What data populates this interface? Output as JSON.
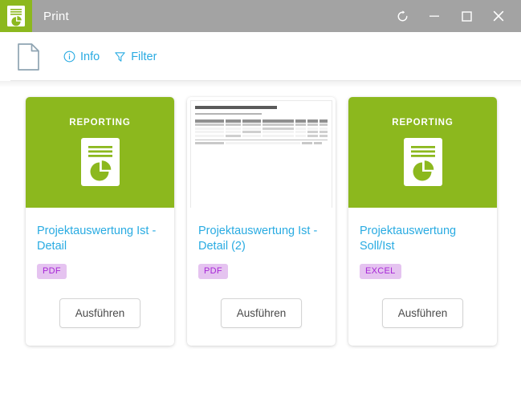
{
  "window": {
    "title": "Print",
    "logo_icon": "report-pie-document-icon",
    "controls": [
      {
        "name": "refresh-button",
        "icon": "refresh-icon"
      },
      {
        "name": "minimize-button",
        "icon": "minimize-icon"
      },
      {
        "name": "maximize-button",
        "icon": "maximize-icon"
      },
      {
        "name": "close-button",
        "icon": "close-icon"
      }
    ],
    "colors": {
      "titlebar": "#a3a3a3",
      "accent_green": "#8cb81e",
      "link_blue": "#29abe2",
      "badge_bg": "#e5c3f0",
      "badge_text": "#a626d6"
    }
  },
  "toolbar": {
    "document_icon": "document-icon",
    "actions": [
      {
        "label": "Info",
        "icon": "info-circle-icon"
      },
      {
        "label": "Filter",
        "icon": "filter-funnel-icon"
      }
    ]
  },
  "cards": [
    {
      "header_type": "reporting",
      "header_label": "REPORTING",
      "header_icon": "report-pie-document-icon",
      "title": "Projektauswertung Ist - Detail",
      "badge": "PDF",
      "button_label": "Ausführen"
    },
    {
      "header_type": "thumbnail",
      "header_label": "",
      "header_icon": "document-preview-thumbnail",
      "title": "Projektauswertung Ist - Detail (2)",
      "badge": "PDF",
      "button_label": "Ausführen"
    },
    {
      "header_type": "reporting",
      "header_label": "REPORTING",
      "header_icon": "report-pie-document-icon",
      "title": "Projektauswertung Soll/Ist",
      "badge": "EXCEL",
      "button_label": "Ausführen"
    }
  ]
}
